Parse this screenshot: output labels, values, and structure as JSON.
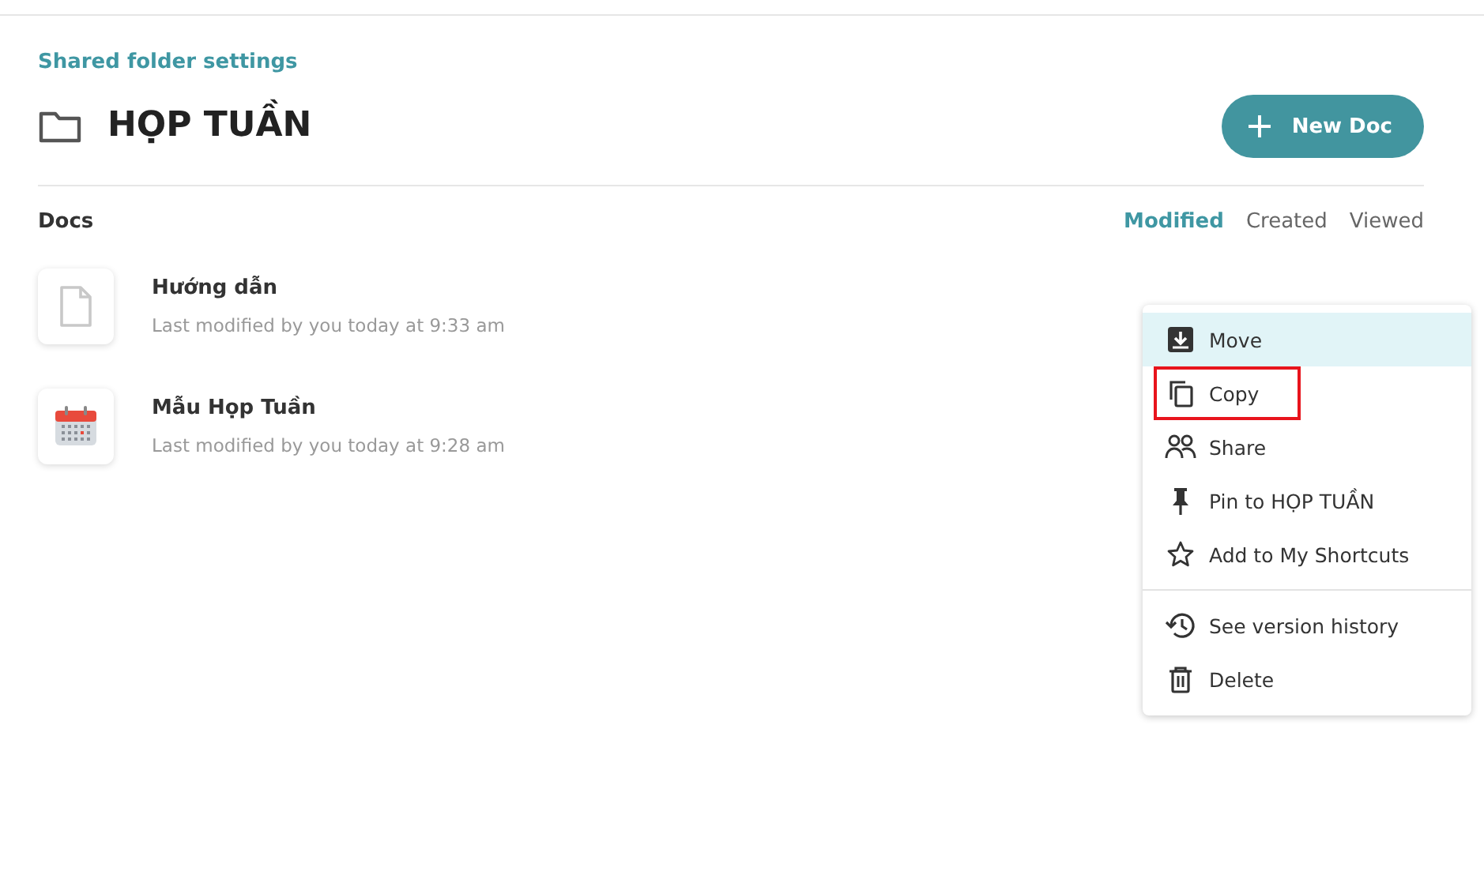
{
  "breadcrumb": "Shared folder settings",
  "folder": {
    "title": "HỌP TUẦN"
  },
  "new_button": {
    "label": "New Doc"
  },
  "section": {
    "title": "Docs"
  },
  "sort_tabs": [
    {
      "label": "Modified",
      "selected": true
    },
    {
      "label": "Created",
      "selected": false
    },
    {
      "label": "Viewed",
      "selected": false
    }
  ],
  "docs": [
    {
      "kind": "blank",
      "title": "Hướng dẫn",
      "meta": "Last modified by you today at 9:33 am"
    },
    {
      "kind": "calendar",
      "title": "Mẫu Họp Tuần",
      "meta": "Last modified by you today at 9:28 am"
    }
  ],
  "menu": {
    "groups": [
      [
        {
          "kind": "move",
          "label": "Move",
          "hovered": true,
          "highlighted": false
        },
        {
          "kind": "copy",
          "label": "Copy",
          "hovered": false,
          "highlighted": true
        },
        {
          "kind": "share",
          "label": "Share",
          "hovered": false,
          "highlighted": false
        },
        {
          "kind": "pin",
          "label": "Pin to HỌP TUẦN",
          "hovered": false,
          "highlighted": false
        },
        {
          "kind": "star",
          "label": "Add to My Shortcuts",
          "hovered": false,
          "highlighted": false
        }
      ],
      [
        {
          "kind": "history",
          "label": "See version history",
          "hovered": false,
          "highlighted": false
        },
        {
          "kind": "delete",
          "label": "Delete",
          "hovered": false,
          "highlighted": false
        }
      ]
    ]
  }
}
